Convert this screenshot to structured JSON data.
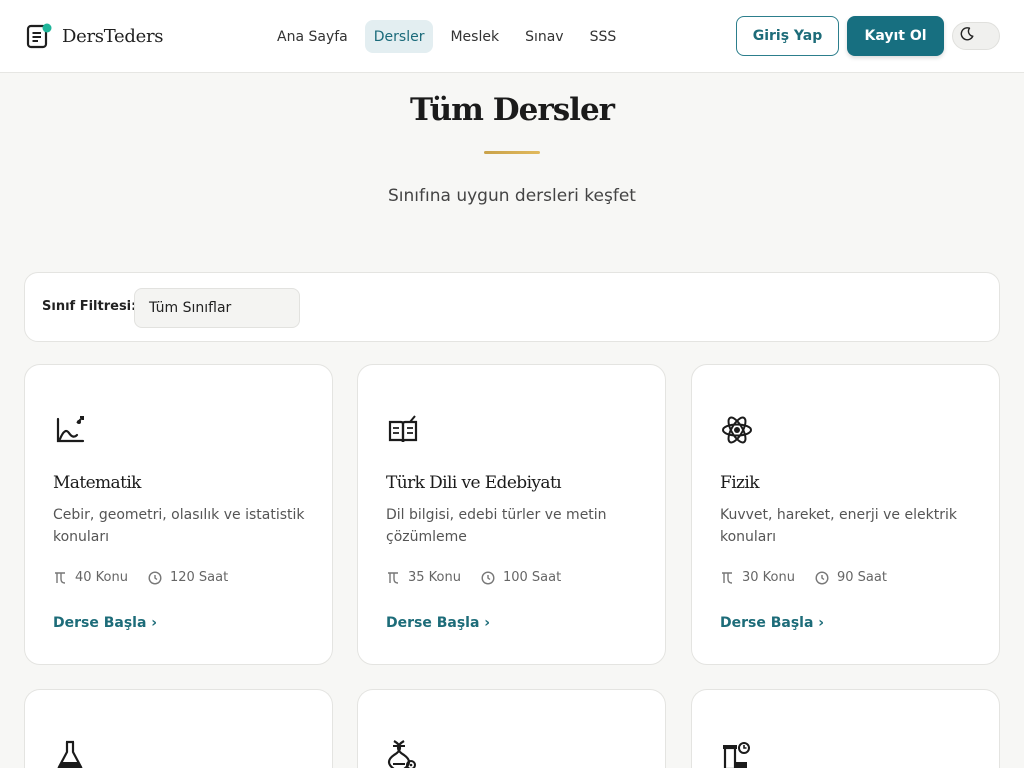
{
  "brand": {
    "name": "DersTeders"
  },
  "nav": {
    "items": [
      {
        "label": "Ana Sayfa",
        "active": false
      },
      {
        "label": "Dersler",
        "active": true
      },
      {
        "label": "Meslek",
        "active": false
      },
      {
        "label": "Sınav",
        "active": false
      },
      {
        "label": "SSS",
        "active": false
      }
    ]
  },
  "auth": {
    "login_label": "Giriş Yap",
    "register_label": "Kayıt Ol"
  },
  "hero": {
    "title": "Tüm Dersler",
    "subtitle": "Sınıfına uygun dersleri keşfet"
  },
  "filter": {
    "label": "Sınıf Filtresi:",
    "selected": "Tüm Sınıflar"
  },
  "courses": [
    {
      "name": "Matematik",
      "description": "Cebir, geometri, olasılık ve istatistik konuları",
      "topics": "40 Konu",
      "hours": "120 Saat",
      "cta": "Derse Başla ›",
      "icon": "chart-graph-icon"
    },
    {
      "name": "Türk Dili ve Edebiyatı",
      "description": "Dil bilgisi, edebi türler ve metin çözümleme",
      "topics": "35 Konu",
      "hours": "100 Saat",
      "cta": "Derse Başla ›",
      "icon": "open-book-icon"
    },
    {
      "name": "Fizik",
      "description": "Kuvvet, hareket, enerji ve elektrik konuları",
      "topics": "30 Konu",
      "hours": "90 Saat",
      "cta": "Derse Başla ›",
      "icon": "atom-icon"
    },
    {
      "icon": "flask-icon"
    },
    {
      "icon": "dna-icon"
    },
    {
      "icon": "history-icon"
    }
  ],
  "colors": {
    "accent": "#176f80",
    "gold": "#c9a24a",
    "nav_active_bg": "#e3eef1"
  }
}
